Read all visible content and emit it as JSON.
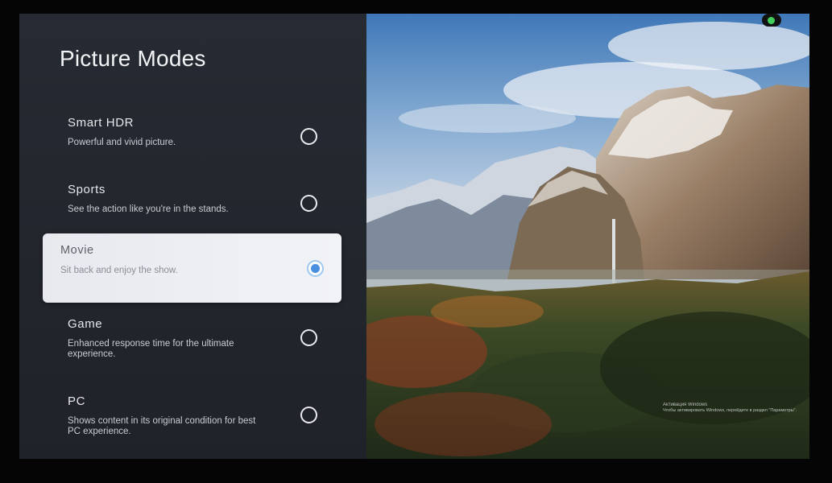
{
  "panel": {
    "title": "Picture Modes",
    "options": [
      {
        "name": "Smart HDR",
        "description": "Powerful and vivid picture.",
        "selected": false
      },
      {
        "name": "Sports",
        "description": "See the action like you're in the stands.",
        "selected": false
      },
      {
        "name": "Movie",
        "description": "Sit back and enjoy the show.",
        "selected": true
      },
      {
        "name": "Game",
        "description": "Enhanced response time for the ultimate experience.",
        "selected": false
      },
      {
        "name": "PC",
        "description": "Shows content in its original condition for best PC experience.",
        "selected": false
      }
    ]
  },
  "preview": {
    "indicator_color": "#3fcf5a",
    "watermark": {
      "title": "Активация Windows",
      "text": "Чтобы активировать Windows, перейдите в раздел \"Параметры\"."
    }
  },
  "colors": {
    "accent": "#4a8ee0",
    "panel_bg": "#262b33",
    "selected_bg": "#eef0f3"
  }
}
